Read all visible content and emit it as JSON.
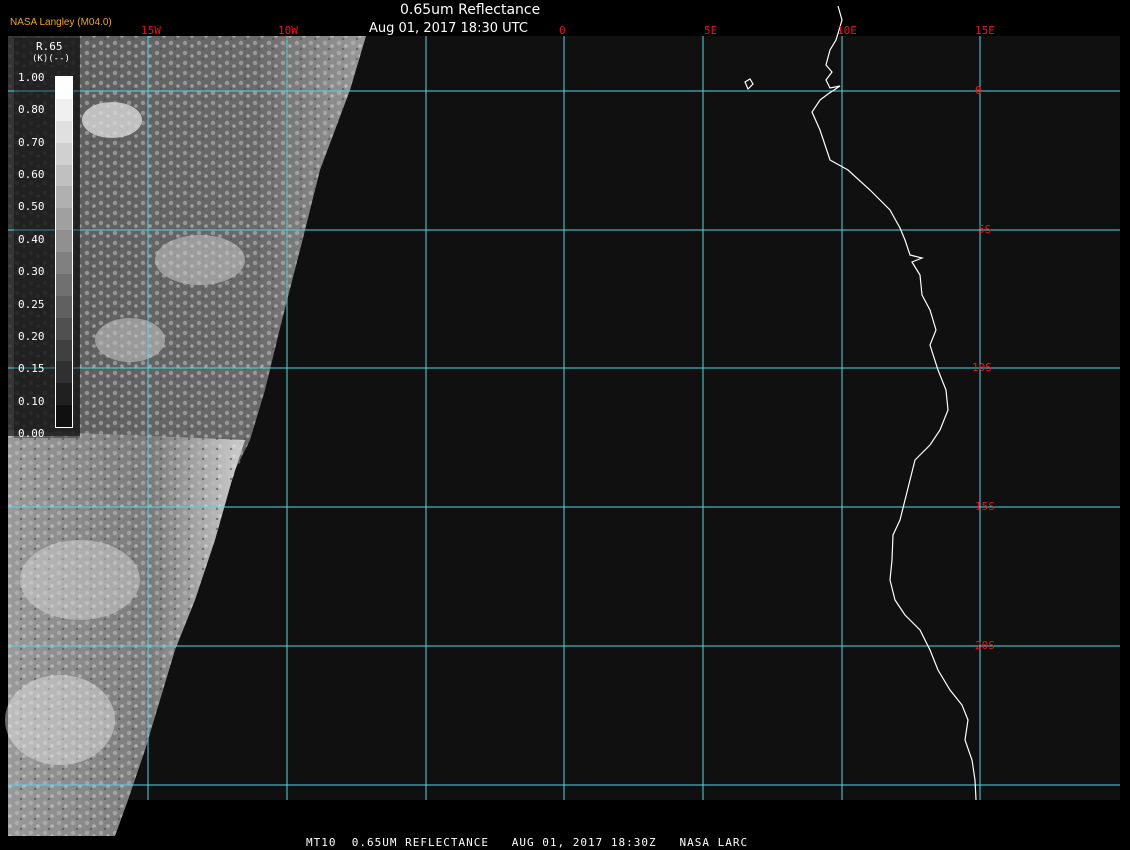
{
  "header": {
    "title": "0.65um Reflectance",
    "subtitle": "Aug 01, 2017 18:30 UTC",
    "credit": "NASA Langley (M04.0)"
  },
  "footer": {
    "text": "MT10  0.65UM REFLECTANCE   AUG 01, 2017 18:30Z   NASA LARC"
  },
  "colorbar": {
    "title": "R.65",
    "unit": "(--)",
    "unit_prefix": "(K)",
    "ticks": [
      "1.00",
      "0.80",
      "0.70",
      "0.60",
      "0.50",
      "0.40",
      "0.30",
      "0.25",
      "0.20",
      "0.15",
      "0.10",
      "0.00"
    ],
    "swatch_colors": [
      "#ffffff",
      "#f0f0f0",
      "#e0e0e0",
      "#d0d0d0",
      "#c0c0c0",
      "#b0b0b0",
      "#a0a0a0",
      "#909090",
      "#808080",
      "#707070",
      "#606060",
      "#505050",
      "#404040",
      "#303030",
      "#202020",
      "#101010"
    ]
  },
  "grid": {
    "lon_labels": [
      "15W",
      "10W",
      "0",
      "5E",
      "10E",
      "15E"
    ],
    "lat_labels": [
      "0",
      "5S",
      "10S",
      "15S",
      "20S"
    ],
    "grid_color": "#4fd6e3",
    "label_color": "#e0191c"
  },
  "map": {
    "background_color": "#111111",
    "coastline_color": "#ffffff"
  }
}
